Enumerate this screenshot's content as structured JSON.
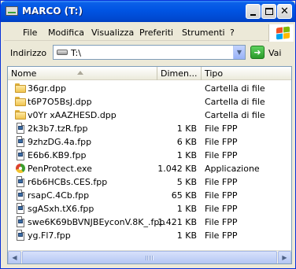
{
  "window": {
    "title": "MARCO (T:)"
  },
  "menu": {
    "items": [
      "File",
      "Modifica",
      "Visualizza",
      "Preferiti",
      "Strumenti",
      "?"
    ]
  },
  "address": {
    "label": "Indirizzo",
    "value": "T:\\",
    "go_label": "Vai"
  },
  "columns": {
    "name": "Nome",
    "size": "Dimen...",
    "type": "Tipo"
  },
  "files": [
    {
      "name": "36gr.dpp",
      "size": "",
      "type": "Cartella di file",
      "icon": "folder-icon"
    },
    {
      "name": "t6P7O5BsJ.dpp",
      "size": "",
      "type": "Cartella di file",
      "icon": "folder-icon"
    },
    {
      "name": "v0Yr xAAZHESD.dpp",
      "size": "",
      "type": "Cartella di file",
      "icon": "folder-icon"
    },
    {
      "name": "2k3b7.tzR.fpp",
      "size": "1 KB",
      "type": "File FPP",
      "icon": "file-icon"
    },
    {
      "name": "9zhzDG.4a.fpp",
      "size": "6 KB",
      "type": "File FPP",
      "icon": "file-icon"
    },
    {
      "name": "E6b6.KB9.fpp",
      "size": "1 KB",
      "type": "File FPP",
      "icon": "file-icon"
    },
    {
      "name": "PenProtect.exe",
      "size": "1.042 KB",
      "type": "Applicazione",
      "icon": "app-icon"
    },
    {
      "name": "r6b6HCBs.CES.fpp",
      "size": "5 KB",
      "type": "File FPP",
      "icon": "file-icon"
    },
    {
      "name": "rsapC.4Cb.fpp",
      "size": "65 KB",
      "type": "File FPP",
      "icon": "file-icon"
    },
    {
      "name": "sgASxh.tX6.fpp",
      "size": "1 KB",
      "type": "File FPP",
      "icon": "file-icon"
    },
    {
      "name": "swe6K69bBVNJBEyconV.8K_.fpp",
      "size": "1.421 KB",
      "type": "File FPP",
      "icon": "file-icon"
    },
    {
      "name": "yg.Fl7.fpp",
      "size": "1 KB",
      "type": "File FPP",
      "icon": "file-icon"
    }
  ]
}
